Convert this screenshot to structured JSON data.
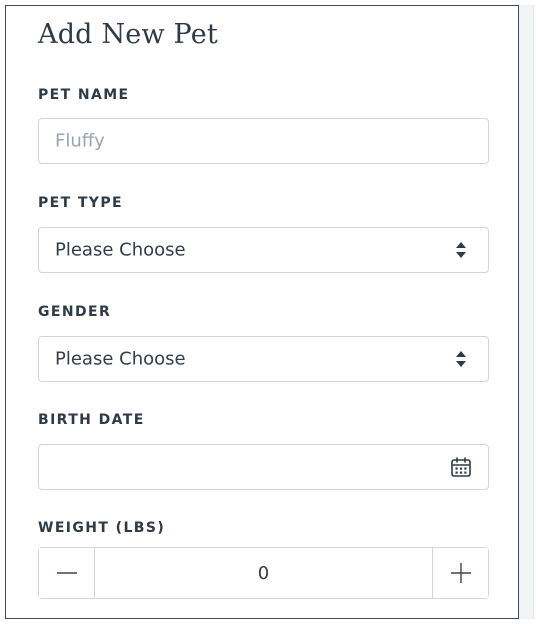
{
  "form": {
    "title": "Add New Pet",
    "pet_name": {
      "label": "PET NAME",
      "placeholder": "Fluffy"
    },
    "pet_type": {
      "label": "PET TYPE",
      "selected": "Please Choose"
    },
    "gender": {
      "label": "GENDER",
      "selected": "Please Choose"
    },
    "birth_date": {
      "label": "BIRTH DATE",
      "value": ""
    },
    "weight": {
      "label": "WEIGHT (LBS)",
      "value": "0"
    }
  },
  "icons": {
    "select_arrows": "sort-arrows-icon",
    "calendar": "calendar-icon",
    "minus": "minus-icon",
    "plus": "plus-icon"
  },
  "colors": {
    "text": "#2f3a47",
    "placeholder": "#9aa4ad",
    "border": "#cfd6dd",
    "card_border": "#3f4a56"
  }
}
